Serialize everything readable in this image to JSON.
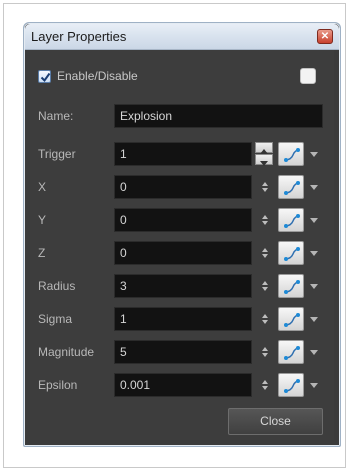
{
  "window": {
    "title": "Layer Properties"
  },
  "enable": {
    "label": "Enable/Disable",
    "checked": true
  },
  "name": {
    "label": "Name:",
    "value": "Explosion"
  },
  "params": [
    {
      "label": "Trigger",
      "value": "1",
      "icon": "function-curve-icon"
    },
    {
      "label": "X",
      "value": "0",
      "icon": "function-curve-icon"
    },
    {
      "label": "Y",
      "value": "0",
      "icon": "function-curve-icon"
    },
    {
      "label": "Z",
      "value": "0",
      "icon": "function-curve-icon"
    },
    {
      "label": "Radius",
      "value": "3",
      "icon": "function-curve-icon"
    },
    {
      "label": "Sigma",
      "value": "1",
      "icon": "function-curve-icon"
    },
    {
      "label": "Magnitude",
      "value": "5",
      "icon": "function-curve-icon"
    },
    {
      "label": "Epsilon",
      "value": "0.001",
      "icon": "function-curve-icon"
    }
  ],
  "footer": {
    "close_label": "Close"
  },
  "colors": {
    "panel": "#3d3d3d",
    "field": "#121212",
    "title_bar": "#d8e2ee",
    "close_x": "#c8412d"
  }
}
